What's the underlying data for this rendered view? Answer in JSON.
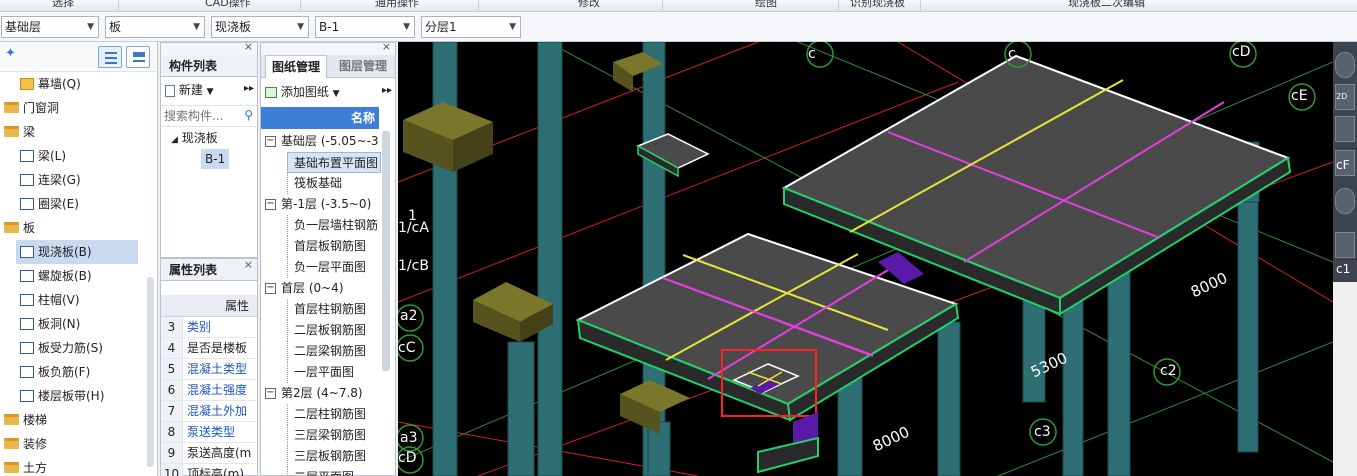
{
  "menubar": {
    "items": [
      "选择",
      "CAD操作",
      "通用操作",
      "修改",
      "绘图",
      "识别现浇板",
      "现浇板二次编辑"
    ]
  },
  "toolbar": {
    "floor_select": "基础层",
    "category_select": "板",
    "type_select": "现浇板",
    "component_select": "B-1",
    "layer_select": "分层1"
  },
  "nav_tree": {
    "items": [
      {
        "label": "幕墙(Q)",
        "kind": "child",
        "icon": "curtain-wall-icon"
      },
      {
        "label": "门窗洞",
        "kind": "folder"
      },
      {
        "label": "梁",
        "kind": "folder-open"
      },
      {
        "label": "梁(L)",
        "kind": "child",
        "icon": "beam-icon"
      },
      {
        "label": "连梁(G)",
        "kind": "child",
        "icon": "link-beam-icon"
      },
      {
        "label": "圈梁(E)",
        "kind": "child",
        "icon": "ring-beam-icon"
      },
      {
        "label": "板",
        "kind": "folder-open"
      },
      {
        "label": "现浇板(B)",
        "kind": "child",
        "icon": "cast-slab-icon",
        "selected": true
      },
      {
        "label": "螺旋板(B)",
        "kind": "child",
        "icon": "spiral-slab-icon"
      },
      {
        "label": "柱帽(V)",
        "kind": "child",
        "icon": "column-cap-icon"
      },
      {
        "label": "板洞(N)",
        "kind": "child",
        "icon": "slab-hole-icon"
      },
      {
        "label": "板受力筋(S)",
        "kind": "child",
        "icon": "slab-rebar-icon"
      },
      {
        "label": "板负筋(F)",
        "kind": "child",
        "icon": "negative-rebar-icon"
      },
      {
        "label": "楼层板带(H)",
        "kind": "child",
        "icon": "slab-strip-icon"
      },
      {
        "label": "楼梯",
        "kind": "folder"
      },
      {
        "label": "装修",
        "kind": "folder"
      },
      {
        "label": "土方",
        "kind": "folder"
      }
    ]
  },
  "component_list": {
    "title": "构件列表",
    "new_button": "新建",
    "search_placeholder": "搜索构件...",
    "tree": {
      "parent": "现浇板",
      "child": "B-1"
    }
  },
  "property_list": {
    "title": "属性列表",
    "header": "属性",
    "rows": [
      {
        "num": "3",
        "name": "类别",
        "blue": true
      },
      {
        "num": "4",
        "name": "是否是楼板",
        "blue": false
      },
      {
        "num": "5",
        "name": "混凝土类型",
        "blue": true
      },
      {
        "num": "6",
        "name": "混凝土强度",
        "blue": true
      },
      {
        "num": "7",
        "name": "混凝土外加",
        "blue": true
      },
      {
        "num": "8",
        "name": "泵送类型",
        "blue": true
      },
      {
        "num": "9",
        "name": "泵送高度(m",
        "blue": false
      },
      {
        "num": "10",
        "name": "顶标高(m)",
        "blue": false
      }
    ]
  },
  "drawing_panel": {
    "tabs": [
      "图纸管理",
      "图层管理"
    ],
    "add_button": "添加图纸",
    "column_header": "名称",
    "groups": [
      {
        "label": "基础层 (-5.05~-3",
        "items": [
          "基础布置平面图",
          "筏板基础"
        ]
      },
      {
        "label": "第-1层 (-3.5~0)",
        "items": [
          "负一层墙柱钢筋",
          "首层板钢筋图",
          "负一层平面图"
        ]
      },
      {
        "label": "首层 (0~4)",
        "items": [
          "首层柱钢筋图",
          "二层板钢筋图",
          "二层梁钢筋图",
          "一层平面图"
        ]
      },
      {
        "label": "第2层 (4~7.8)",
        "items": [
          "二层柱钢筋图",
          "三层梁钢筋图",
          "三层板钢筋图",
          "二层平面图"
        ]
      }
    ]
  },
  "cad_view": {
    "axis_labels": [
      "cD",
      "cE",
      "1/cA",
      "1/cB",
      "a2",
      "cC",
      "a3",
      "cD",
      "c2",
      "c3",
      "c",
      "c",
      "1",
      "cF",
      "c1"
    ],
    "dimensions": [
      "8000",
      "5300",
      "8000"
    ],
    "colors": {
      "slab": "#4a4a4a",
      "edge": "#1fd16a",
      "column": "#2e6f73",
      "cap": "#57531e",
      "magenta": "#e040e0",
      "yellow": "#e6e63a",
      "red": "#ff2020"
    }
  },
  "right_toolbar": {
    "labels": [
      "2D",
      "cF",
      "c1"
    ]
  }
}
